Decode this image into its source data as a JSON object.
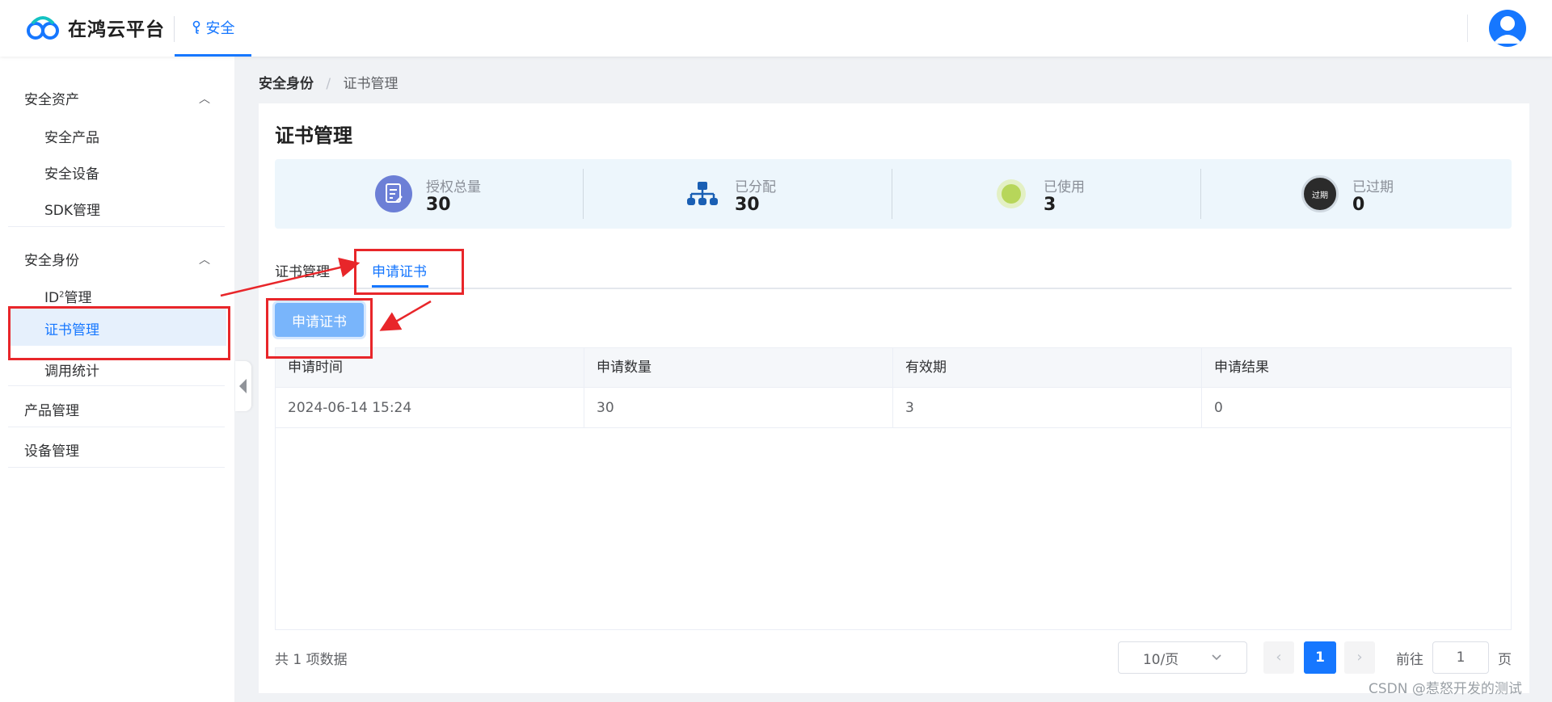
{
  "header": {
    "brand": "在鸿云平台",
    "nav_tab": "安全"
  },
  "sidebar": {
    "group1": {
      "title": "安全资产",
      "items": [
        "安全产品",
        "安全设备",
        "SDK管理"
      ]
    },
    "group2": {
      "title": "安全身份",
      "item_id_prefix": "ID",
      "item_id_sup": "2",
      "item_id_suffix": "管理",
      "active_item": "证书管理",
      "item_stats": "调用统计"
    },
    "product_mgmt": "产品管理",
    "device_mgmt": "设备管理"
  },
  "breadcrumb": {
    "parent": "安全身份",
    "separator": "/",
    "current": "证书管理"
  },
  "page": {
    "title": "证书管理"
  },
  "stats": [
    {
      "label": "授权总量",
      "value": "30",
      "icon": "document-edit-icon"
    },
    {
      "label": "已分配",
      "value": "30",
      "icon": "org-tree-icon"
    },
    {
      "label": "已使用",
      "value": "3",
      "icon": "green-dot-icon"
    },
    {
      "label": "已过期",
      "value": "0",
      "icon": "expired-badge-icon",
      "badge_text": "过期"
    }
  ],
  "tabs": {
    "items": [
      "证书管理",
      "申请证书"
    ],
    "active": "申请证书"
  },
  "apply_button": "申请证书",
  "table": {
    "headers": [
      "申请时间",
      "申请数量",
      "有效期",
      "申请结果"
    ],
    "rows": [
      [
        "2024-06-14 15:24",
        "30",
        "3",
        "0"
      ]
    ]
  },
  "pagination": {
    "total": "共 1 项数据",
    "page_size": "10/页",
    "current_page": "1",
    "goto_prefix": "前往",
    "goto_value": "1",
    "goto_suffix": "页"
  },
  "watermark": "CSDN @惹怒开发的测试",
  "colors": {
    "accent": "#1677ff",
    "annotation": "#e8262a"
  }
}
